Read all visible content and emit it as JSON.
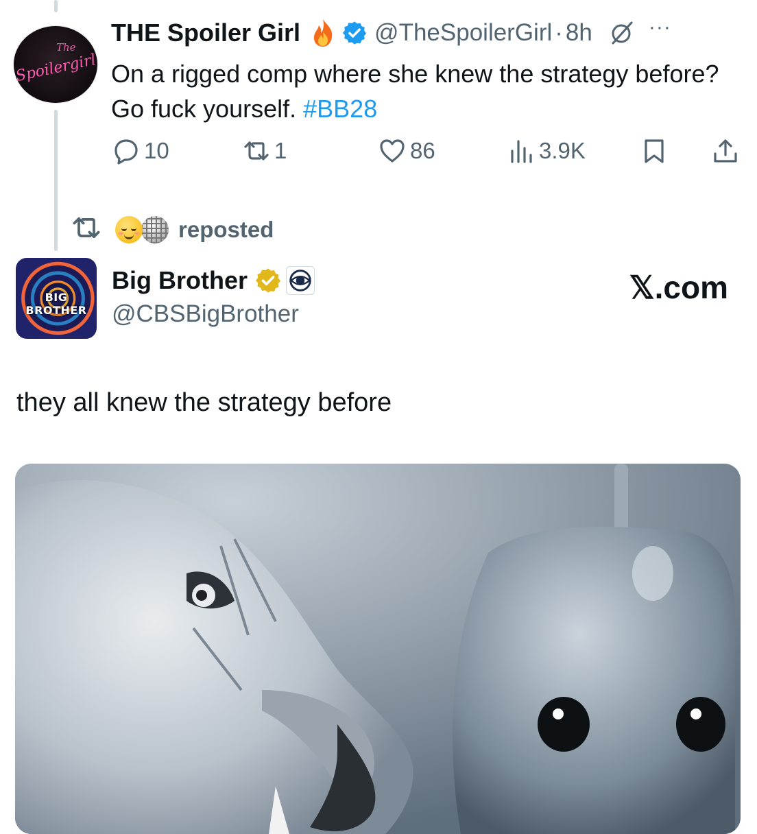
{
  "tweet1": {
    "author_name": "THE Spoiler Girl",
    "handle": "@TheSpoilerGirl",
    "separator": "·",
    "time": "8h",
    "more": "···",
    "text_main": "On a rigged comp where she knew the strategy before? Go fuck yourself.",
    "hashtag": "#BB28",
    "avatar_small_text": "The",
    "avatar_main_text": "Spoilergirl",
    "stats": {
      "replies": "10",
      "reposts": "1",
      "likes": "86",
      "views": "3.9K"
    }
  },
  "repost_bar": {
    "label": "reposted"
  },
  "tweet2": {
    "author_name": "Big Brother",
    "handle": "@CBSBigBrother",
    "avatar_text": "BIG BROTHER",
    "watermark": "𝕏.com",
    "text": "they all knew the strategy before"
  },
  "colors": {
    "link_blue": "#1d9bf0",
    "verified_blue": "#1d9bf0",
    "verified_gold": "#e2b719",
    "muted_text": "#536471",
    "brand_pink": "#ff5db1"
  },
  "icons": [
    "fire-icon",
    "verified-icon",
    "grok-icon",
    "more-icon",
    "reply-icon",
    "repost-icon",
    "like-icon",
    "views-icon",
    "bookmark-icon",
    "share-icon",
    "gold-verified-icon",
    "cbs-eye-icon"
  ]
}
